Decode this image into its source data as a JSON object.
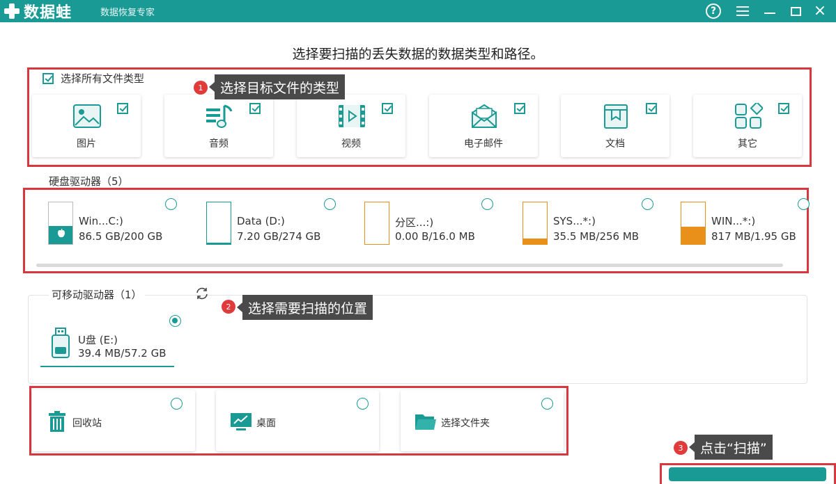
{
  "app": {
    "brand": "数据蛙",
    "subtitle": "数据恢复专家",
    "help_glyph": "?",
    "close_glyph": "×"
  },
  "heading": "选择要扫描的丢失数据的数据类型和路径。",
  "file_types": {
    "select_all_label": "选择所有文件类型",
    "select_all_checked": true,
    "items": [
      {
        "label": "图片",
        "icon": "image-icon",
        "checked": true
      },
      {
        "label": "音频",
        "icon": "audio-icon",
        "checked": true
      },
      {
        "label": "视频",
        "icon": "video-icon",
        "checked": true
      },
      {
        "label": "电子邮件",
        "icon": "email-icon",
        "checked": true
      },
      {
        "label": "文档",
        "icon": "document-icon",
        "checked": true
      },
      {
        "label": "其它",
        "icon": "other-icon",
        "checked": true
      }
    ]
  },
  "callouts": [
    {
      "number": "1",
      "text": "选择目标文件的类型"
    },
    {
      "number": "2",
      "text": "选择需要扫描的位置"
    },
    {
      "number": "3",
      "text": "点击“扫描”"
    }
  ],
  "hard_drives": {
    "title": "硬盘驱动器（5）",
    "items": [
      {
        "name": "Win...C:)",
        "size": "86.5 GB/200 GB",
        "used_fraction": 0.43,
        "color": "#1a9a94",
        "selected": false
      },
      {
        "name": "Data (D:)",
        "size": "7.20 GB/274 GB",
        "used_fraction": 0.03,
        "color": "#1a9a94",
        "selected": false
      },
      {
        "name": "分区...:)",
        "size": "0.00  B/16.0 MB",
        "used_fraction": 0.0,
        "color": "#e8901a",
        "selected": false
      },
      {
        "name": "SYS...*:)",
        "size": "35.5 MB/256 MB",
        "used_fraction": 0.14,
        "color": "#e8901a",
        "selected": false
      },
      {
        "name": "WIN...*:)",
        "size": "817 MB/1.95 GB",
        "used_fraction": 0.41,
        "color": "#e8901a",
        "selected": false
      }
    ]
  },
  "removable_drives": {
    "title": "可移动驱动器（1）",
    "items": [
      {
        "name": "U盘 (E:)",
        "size": "39.4 MB/57.2 GB",
        "selected": true
      }
    ]
  },
  "locations": [
    {
      "label": "回收站",
      "icon": "recycle-bin-icon",
      "selected": false
    },
    {
      "label": "桌面",
      "icon": "desktop-icon",
      "selected": false
    },
    {
      "label": "选择文件夹",
      "icon": "folder-icon",
      "selected": false
    }
  ],
  "colors": {
    "accent": "#1a9a94",
    "annotation": "#d9363e",
    "warning": "#e8901a"
  }
}
